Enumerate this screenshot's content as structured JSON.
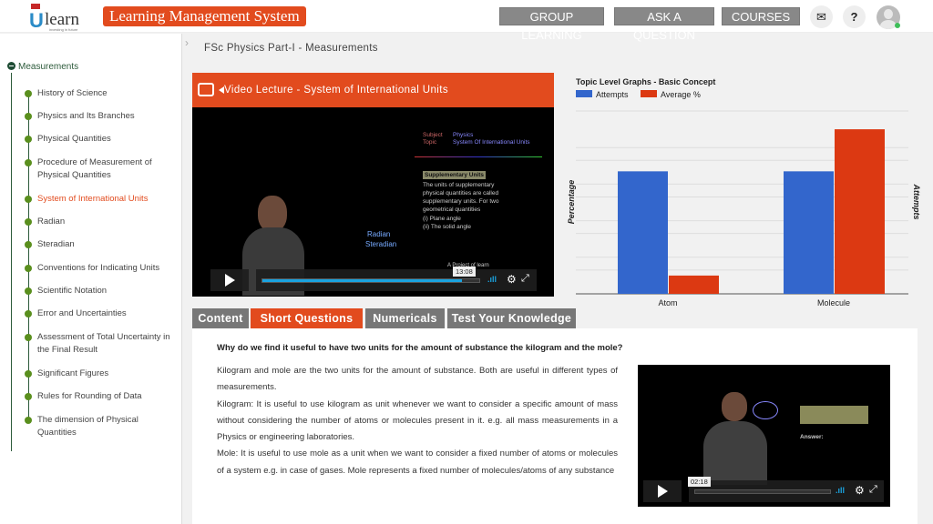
{
  "header": {
    "logo_text": "learn",
    "logo_tagline": "investing in future",
    "app_title": "Learning Management System",
    "nav": [
      {
        "label": "GROUP LEARNING"
      },
      {
        "label": "ASK A QUESTION"
      },
      {
        "label": "COURSES"
      }
    ],
    "icons": [
      "mail-icon",
      "help-icon",
      "avatar-icon"
    ],
    "help_label": "?"
  },
  "sidebar": {
    "root": "Measurements",
    "items": [
      {
        "label": "History of Science"
      },
      {
        "label": "Physics and Its Branches"
      },
      {
        "label": "Physical Quantities"
      },
      {
        "label": "Procedure of Measurement of Physical Quantities"
      },
      {
        "label": "System of International Units",
        "active": true
      },
      {
        "label": "Radian"
      },
      {
        "label": "Steradian"
      },
      {
        "label": "Conventions for Indicating Units"
      },
      {
        "label": "Scientific Notation"
      },
      {
        "label": "Error and Uncertainties"
      },
      {
        "label": "Assessment of Total Uncertainty in the Final Result"
      },
      {
        "label": "Significant Figures"
      },
      {
        "label": "Rules for Rounding of Data"
      },
      {
        "label": "The dimension of Physical Quantities"
      }
    ]
  },
  "breadcrumb": "FSc Physics Part-I - Measurements",
  "video": {
    "title": "Video Lecture - System of International Units",
    "subject_label": "Subject",
    "subject": "Physics",
    "topic_label": "Topic",
    "topic": "System Of International Units",
    "slide_heading": "Supplementary Units",
    "slide_text": "The units of supplementary physical quantities are called supplementary units. For two geometrical quantities",
    "slide_item1": "(i) Plane angle",
    "slide_item2": "(ii) The solid angle",
    "board1": "Radian",
    "board2": "Steradian",
    "watermark": "A Project of learn",
    "time_tooltip": "13:08",
    "progress_percent": 92
  },
  "chart_data": {
    "type": "bar",
    "title": "Topic Level Graphs - Basic Concept",
    "categories": [
      "Atom",
      "Molecule"
    ],
    "series": [
      {
        "name": "Attempts",
        "values": [
          0.67,
          0.67
        ],
        "color": "#3366cc"
      },
      {
        "name": "Average %",
        "values": [
          0.1,
          0.9
        ],
        "color": "#dc3912"
      }
    ],
    "ylabel": "Percentage",
    "y2label": "Attempts",
    "ylim": [
      0,
      1
    ],
    "grid": true,
    "legend": "top-left"
  },
  "tabs": [
    {
      "label": "Content"
    },
    {
      "label": "Short Questions",
      "active": true
    },
    {
      "label": "Numericals"
    },
    {
      "label": "Test Your Knowledge"
    }
  ],
  "question": "Why do we find it useful to have two units for the amount of substance the kilogram and the mole?",
  "answer": [
    "Kilogram and mole are the two units for the amount of substance. Both are useful in different types of measurements.",
    "Kilogram:  It is useful to use kilogram as unit whenever we want to consider a specific amount of mass without considering the number of atoms or molecules present in it. e.g. all mass measurements in a Physics or engineering laboratories.",
    "Mole:  It is useful to use mole as a unit when we want to consider a fixed number of atoms or molecules of a system e.g. in case of gases. Mole represents a fixed number of molecules/atoms of any substance"
  ],
  "video2": {
    "time_tooltip": "02:18",
    "progress_percent": 0,
    "answer_label": "Answer:"
  },
  "colors": {
    "accent": "#e24b1e",
    "nav": "#888888",
    "tree": "#5a8f1e"
  }
}
